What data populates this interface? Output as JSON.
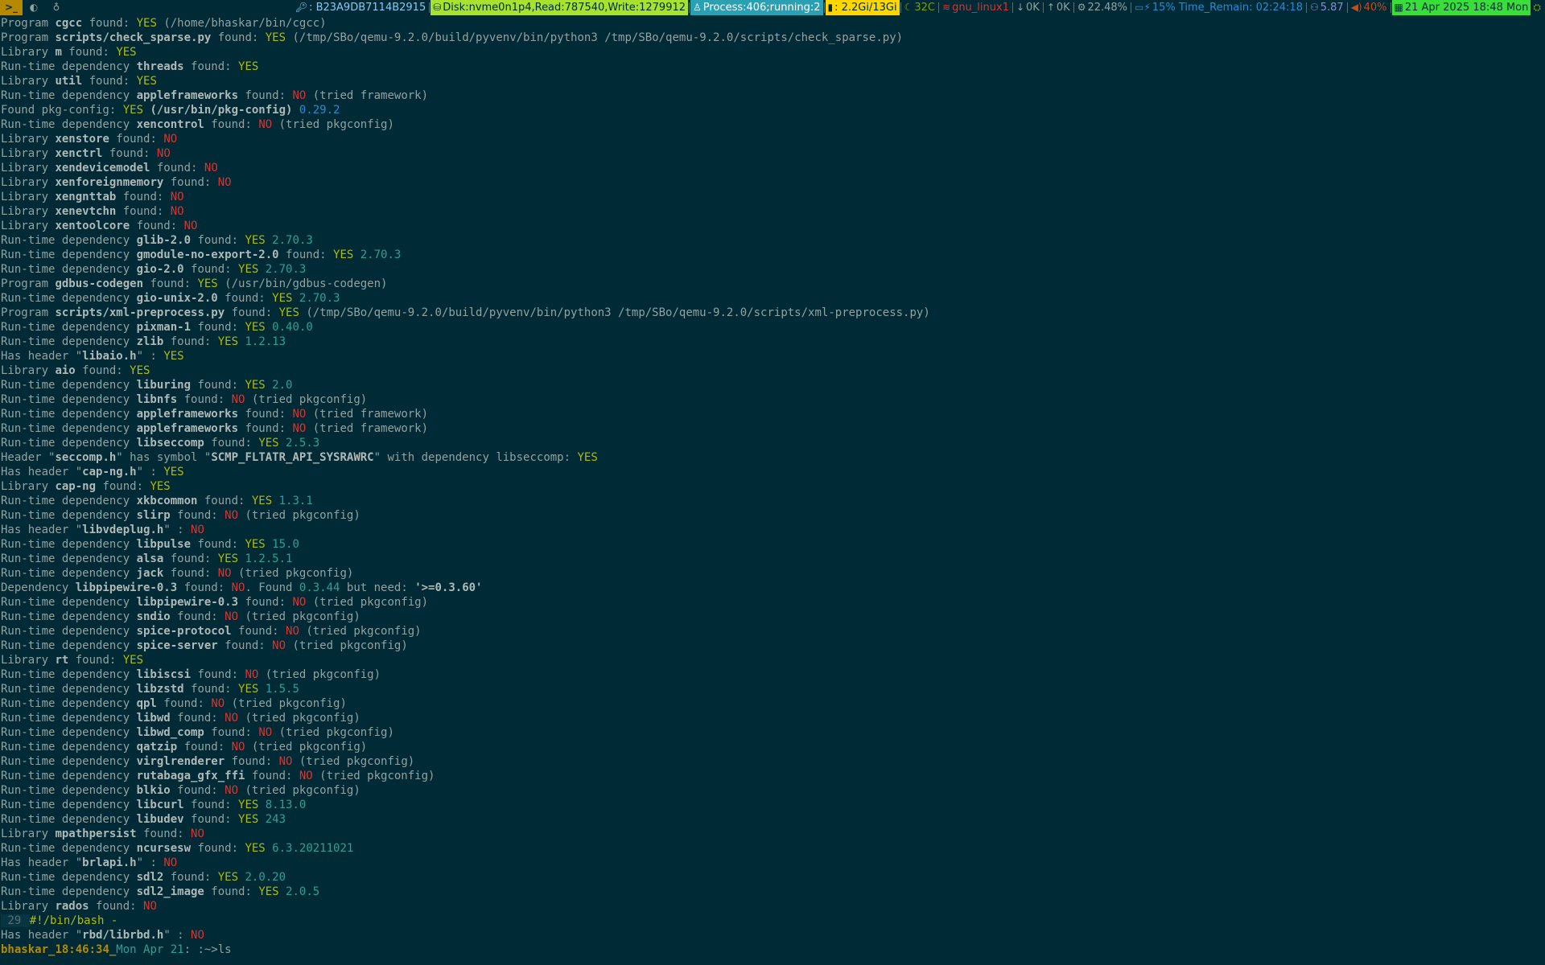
{
  "statusbar": {
    "workspaces": [
      {
        "label": ">_",
        "icon": "terminal-icon",
        "active": true
      },
      {
        "label": "◐",
        "icon": "browser-icon",
        "active": false
      },
      {
        "label": "♁",
        "icon": "linux-icon",
        "active": false
      }
    ],
    "key": ": B23A9DB7114B2915",
    "disk": "Disk:nvme0n1p4,Read:787540,Write:1279912",
    "process": "Process:406;running:2",
    "memory": ": 2.2Gi/13Gi",
    "temp": "32C",
    "network": "gnu_linux1",
    "down": "0K",
    "up": "0K",
    "cpu": "22.48%",
    "battery": "15% Time_Remain: 02:24:18",
    "load": "5.87",
    "volume": "40%",
    "datetime": "21 Apr 2025 18:48 Mon"
  },
  "terminal": {
    "lines": [
      [
        [
          "n",
          "Program "
        ],
        [
          "w",
          "cgcc"
        ],
        [
          "n",
          " found: "
        ],
        [
          "y",
          "YES"
        ],
        [
          "n",
          " (/home/bhaskar/bin/cgcc)"
        ]
      ],
      [
        [
          "n",
          "Program "
        ],
        [
          "w",
          "scripts/check_sparse.py"
        ],
        [
          "n",
          " found: "
        ],
        [
          "y",
          "YES"
        ],
        [
          "n",
          " (/tmp/SBo/qemu-9.2.0/build/pyvenv/bin/python3 /tmp/SBo/qemu-9.2.0/scripts/check_sparse.py)"
        ]
      ],
      [
        [
          "n",
          "Library "
        ],
        [
          "w",
          "m"
        ],
        [
          "n",
          " found: "
        ],
        [
          "y",
          "YES"
        ]
      ],
      [
        [
          "n",
          "Run-time dependency "
        ],
        [
          "w",
          "threads"
        ],
        [
          "n",
          " found: "
        ],
        [
          "y",
          "YES"
        ]
      ],
      [
        [
          "n",
          "Library "
        ],
        [
          "w",
          "util"
        ],
        [
          "n",
          " found: "
        ],
        [
          "y",
          "YES"
        ]
      ],
      [
        [
          "n",
          "Run-time dependency "
        ],
        [
          "w",
          "appleframeworks"
        ],
        [
          "n",
          " found: "
        ],
        [
          "r",
          "NO"
        ],
        [
          "n",
          " (tried framework)"
        ]
      ],
      [
        [
          "n",
          "Found pkg-config: "
        ],
        [
          "y",
          "YES"
        ],
        [
          "w",
          " (/usr/bin/pkg-config)"
        ],
        [
          "hl",
          " 0.29.2"
        ]
      ],
      [
        [
          "n",
          "Run-time dependency "
        ],
        [
          "w",
          "xencontrol"
        ],
        [
          "n",
          " found: "
        ],
        [
          "r",
          "NO"
        ],
        [
          "n",
          " (tried pkgconfig)"
        ]
      ],
      [
        [
          "n",
          "Library "
        ],
        [
          "w",
          "xenstore"
        ],
        [
          "n",
          " found: "
        ],
        [
          "r",
          "NO"
        ]
      ],
      [
        [
          "n",
          "Library "
        ],
        [
          "w",
          "xenctrl"
        ],
        [
          "n",
          " found: "
        ],
        [
          "r",
          "NO"
        ]
      ],
      [
        [
          "n",
          "Library "
        ],
        [
          "w",
          "xendevicemodel"
        ],
        [
          "n",
          " found: "
        ],
        [
          "r",
          "NO"
        ]
      ],
      [
        [
          "n",
          "Library "
        ],
        [
          "w",
          "xenforeignmemory"
        ],
        [
          "n",
          " found: "
        ],
        [
          "r",
          "NO"
        ]
      ],
      [
        [
          "n",
          "Library "
        ],
        [
          "w",
          "xengnttab"
        ],
        [
          "n",
          " found: "
        ],
        [
          "r",
          "NO"
        ]
      ],
      [
        [
          "n",
          "Library "
        ],
        [
          "w",
          "xenevtchn"
        ],
        [
          "n",
          " found: "
        ],
        [
          "r",
          "NO"
        ]
      ],
      [
        [
          "n",
          "Library "
        ],
        [
          "w",
          "xentoolcore"
        ],
        [
          "n",
          " found: "
        ],
        [
          "r",
          "NO"
        ]
      ],
      [
        [
          "n",
          "Run-time dependency "
        ],
        [
          "w",
          "glib-2.0"
        ],
        [
          "n",
          " found: "
        ],
        [
          "y",
          "YES"
        ],
        [
          "c",
          " 2.70.3"
        ]
      ],
      [
        [
          "n",
          "Run-time dependency "
        ],
        [
          "w",
          "gmodule-no-export-2.0"
        ],
        [
          "n",
          " found: "
        ],
        [
          "y",
          "YES"
        ],
        [
          "c",
          " 2.70.3"
        ]
      ],
      [
        [
          "n",
          "Run-time dependency "
        ],
        [
          "w",
          "gio-2.0"
        ],
        [
          "n",
          " found: "
        ],
        [
          "y",
          "YES"
        ],
        [
          "c",
          " 2.70.3"
        ]
      ],
      [
        [
          "n",
          "Program "
        ],
        [
          "w",
          "gdbus-codegen"
        ],
        [
          "n",
          " found: "
        ],
        [
          "y",
          "YES"
        ],
        [
          "n",
          " (/usr/bin/gdbus-codegen)"
        ]
      ],
      [
        [
          "n",
          "Run-time dependency "
        ],
        [
          "w",
          "gio-unix-2.0"
        ],
        [
          "n",
          " found: "
        ],
        [
          "y",
          "YES"
        ],
        [
          "c",
          " 2.70.3"
        ]
      ],
      [
        [
          "n",
          "Program "
        ],
        [
          "w",
          "scripts/xml-preprocess.py"
        ],
        [
          "n",
          " found: "
        ],
        [
          "y",
          "YES"
        ],
        [
          "n",
          " (/tmp/SBo/qemu-9.2.0/build/pyvenv/bin/python3 /tmp/SBo/qemu-9.2.0/scripts/xml-preprocess.py)"
        ]
      ],
      [
        [
          "n",
          "Run-time dependency "
        ],
        [
          "w",
          "pixman-1"
        ],
        [
          "n",
          " found: "
        ],
        [
          "y",
          "YES"
        ],
        [
          "c",
          " 0.40.0"
        ]
      ],
      [
        [
          "n",
          "Run-time dependency "
        ],
        [
          "w",
          "zlib"
        ],
        [
          "n",
          " found: "
        ],
        [
          "y",
          "YES"
        ],
        [
          "c",
          " 1.2.13"
        ]
      ],
      [
        [
          "n",
          "Has header \""
        ],
        [
          "w",
          "libaio.h"
        ],
        [
          "n",
          "\" : "
        ],
        [
          "y",
          "YES"
        ]
      ],
      [
        [
          "n",
          "Library "
        ],
        [
          "w",
          "aio"
        ],
        [
          "n",
          " found: "
        ],
        [
          "y",
          "YES"
        ]
      ],
      [
        [
          "n",
          "Run-time dependency "
        ],
        [
          "w",
          "liburing"
        ],
        [
          "n",
          " found: "
        ],
        [
          "y",
          "YES"
        ],
        [
          "c",
          " 2.0"
        ]
      ],
      [
        [
          "n",
          "Run-time dependency "
        ],
        [
          "w",
          "libnfs"
        ],
        [
          "n",
          " found: "
        ],
        [
          "r",
          "NO"
        ],
        [
          "n",
          " (tried pkgconfig)"
        ]
      ],
      [
        [
          "n",
          "Run-time dependency "
        ],
        [
          "w",
          "appleframeworks"
        ],
        [
          "n",
          " found: "
        ],
        [
          "r",
          "NO"
        ],
        [
          "n",
          " (tried framework)"
        ]
      ],
      [
        [
          "n",
          "Run-time dependency "
        ],
        [
          "w",
          "appleframeworks"
        ],
        [
          "n",
          " found: "
        ],
        [
          "r",
          "NO"
        ],
        [
          "n",
          " (tried framework)"
        ]
      ],
      [
        [
          "n",
          "Run-time dependency "
        ],
        [
          "w",
          "libseccomp"
        ],
        [
          "n",
          " found: "
        ],
        [
          "y",
          "YES"
        ],
        [
          "c",
          " 2.5.3"
        ]
      ],
      [
        [
          "n",
          "Header \""
        ],
        [
          "w",
          "seccomp.h"
        ],
        [
          "n",
          "\" has symbol \""
        ],
        [
          "w",
          "SCMP_FLTATR_API_SYSRAWRC"
        ],
        [
          "n",
          "\" with dependency libseccomp: "
        ],
        [
          "y",
          "YES"
        ]
      ],
      [
        [
          "n",
          "Has header \""
        ],
        [
          "w",
          "cap-ng.h"
        ],
        [
          "n",
          "\" : "
        ],
        [
          "y",
          "YES"
        ]
      ],
      [
        [
          "n",
          "Library "
        ],
        [
          "w",
          "cap-ng"
        ],
        [
          "n",
          " found: "
        ],
        [
          "y",
          "YES"
        ]
      ],
      [
        [
          "n",
          "Run-time dependency "
        ],
        [
          "w",
          "xkbcommon"
        ],
        [
          "n",
          " found: "
        ],
        [
          "y",
          "YES"
        ],
        [
          "c",
          " 1.3.1"
        ]
      ],
      [
        [
          "n",
          "Run-time dependency "
        ],
        [
          "w",
          "slirp"
        ],
        [
          "n",
          " found: "
        ],
        [
          "r",
          "NO"
        ],
        [
          "n",
          " (tried pkgconfig)"
        ]
      ],
      [
        [
          "n",
          "Has header \""
        ],
        [
          "w",
          "libvdeplug.h"
        ],
        [
          "n",
          "\" : "
        ],
        [
          "r",
          "NO"
        ]
      ],
      [
        [
          "n",
          "Run-time dependency "
        ],
        [
          "w",
          "libpulse"
        ],
        [
          "n",
          " found: "
        ],
        [
          "y",
          "YES"
        ],
        [
          "c",
          " 15.0"
        ]
      ],
      [
        [
          "n",
          "Run-time dependency "
        ],
        [
          "w",
          "alsa"
        ],
        [
          "n",
          " found: "
        ],
        [
          "y",
          "YES"
        ],
        [
          "c",
          " 1.2.5.1"
        ]
      ],
      [
        [
          "n",
          "Run-time dependency "
        ],
        [
          "w",
          "jack"
        ],
        [
          "n",
          " found: "
        ],
        [
          "r",
          "NO"
        ],
        [
          "n",
          " (tried pkgconfig)"
        ]
      ],
      [
        [
          "n",
          "Dependency "
        ],
        [
          "w",
          "libpipewire-0.3"
        ],
        [
          "n",
          " found: "
        ],
        [
          "r",
          "NO"
        ],
        [
          "n",
          ". Found "
        ],
        [
          "c",
          "0.3.44"
        ],
        [
          "n",
          " but need: "
        ],
        [
          "w",
          "'>=0.3.60'"
        ]
      ],
      [
        [
          "n",
          "Run-time dependency "
        ],
        [
          "w",
          "libpipewire-0.3"
        ],
        [
          "n",
          " found: "
        ],
        [
          "r",
          "NO"
        ],
        [
          "n",
          " (tried pkgconfig)"
        ]
      ],
      [
        [
          "n",
          "Run-time dependency "
        ],
        [
          "w",
          "sndio"
        ],
        [
          "n",
          " found: "
        ],
        [
          "r",
          "NO"
        ],
        [
          "n",
          " (tried pkgconfig)"
        ]
      ],
      [
        [
          "n",
          "Run-time dependency "
        ],
        [
          "w",
          "spice-protocol"
        ],
        [
          "n",
          " found: "
        ],
        [
          "r",
          "NO"
        ],
        [
          "n",
          " (tried pkgconfig)"
        ]
      ],
      [
        [
          "n",
          "Run-time dependency "
        ],
        [
          "w",
          "spice-server"
        ],
        [
          "n",
          " found: "
        ],
        [
          "r",
          "NO"
        ],
        [
          "n",
          " (tried pkgconfig)"
        ]
      ],
      [
        [
          "n",
          "Library "
        ],
        [
          "w",
          "rt"
        ],
        [
          "n",
          " found: "
        ],
        [
          "y",
          "YES"
        ]
      ],
      [
        [
          "n",
          "Run-time dependency "
        ],
        [
          "w",
          "libiscsi"
        ],
        [
          "n",
          " found: "
        ],
        [
          "r",
          "NO"
        ],
        [
          "n",
          " (tried pkgconfig)"
        ]
      ],
      [
        [
          "n",
          "Run-time dependency "
        ],
        [
          "w",
          "libzstd"
        ],
        [
          "n",
          " found: "
        ],
        [
          "y",
          "YES"
        ],
        [
          "c",
          " 1.5.5"
        ]
      ],
      [
        [
          "n",
          "Run-time dependency "
        ],
        [
          "w",
          "qpl"
        ],
        [
          "n",
          " found: "
        ],
        [
          "r",
          "NO"
        ],
        [
          "n",
          " (tried pkgconfig)"
        ]
      ],
      [
        [
          "n",
          "Run-time dependency "
        ],
        [
          "w",
          "libwd"
        ],
        [
          "n",
          " found: "
        ],
        [
          "r",
          "NO"
        ],
        [
          "n",
          " (tried pkgconfig)"
        ]
      ],
      [
        [
          "n",
          "Run-time dependency "
        ],
        [
          "w",
          "libwd_comp"
        ],
        [
          "n",
          " found: "
        ],
        [
          "r",
          "NO"
        ],
        [
          "n",
          " (tried pkgconfig)"
        ]
      ],
      [
        [
          "n",
          "Run-time dependency "
        ],
        [
          "w",
          "qatzip"
        ],
        [
          "n",
          " found: "
        ],
        [
          "r",
          "NO"
        ],
        [
          "n",
          " (tried pkgconfig)"
        ]
      ],
      [
        [
          "n",
          "Run-time dependency "
        ],
        [
          "w",
          "virglrenderer"
        ],
        [
          "n",
          " found: "
        ],
        [
          "r",
          "NO"
        ],
        [
          "n",
          " (tried pkgconfig)"
        ]
      ],
      [
        [
          "n",
          "Run-time dependency "
        ],
        [
          "w",
          "rutabaga_gfx_ffi"
        ],
        [
          "n",
          " found: "
        ],
        [
          "r",
          "NO"
        ],
        [
          "n",
          " (tried pkgconfig)"
        ]
      ],
      [
        [
          "n",
          "Run-time dependency "
        ],
        [
          "w",
          "blkio"
        ],
        [
          "n",
          " found: "
        ],
        [
          "r",
          "NO"
        ],
        [
          "n",
          " (tried pkgconfig)"
        ]
      ],
      [
        [
          "n",
          "Run-time dependency "
        ],
        [
          "w",
          "libcurl"
        ],
        [
          "n",
          " found: "
        ],
        [
          "y",
          "YES"
        ],
        [
          "c",
          " 8.13.0"
        ]
      ],
      [
        [
          "n",
          "Run-time dependency "
        ],
        [
          "w",
          "libudev"
        ],
        [
          "n",
          " found: "
        ],
        [
          "y",
          "YES"
        ],
        [
          "c",
          " 243"
        ]
      ],
      [
        [
          "n",
          "Library "
        ],
        [
          "w",
          "mpathpersist"
        ],
        [
          "n",
          " found: "
        ],
        [
          "r",
          "NO"
        ]
      ],
      [
        [
          "n",
          "Run-time dependency "
        ],
        [
          "w",
          "ncursesw"
        ],
        [
          "n",
          " found: "
        ],
        [
          "y",
          "YES"
        ],
        [
          "c",
          " 6.3.20211021"
        ]
      ],
      [
        [
          "n",
          "Has header \""
        ],
        [
          "w",
          "brlapi.h"
        ],
        [
          "n",
          "\" : "
        ],
        [
          "r",
          "NO"
        ]
      ],
      [
        [
          "n",
          "Run-time dependency "
        ],
        [
          "w",
          "sdl2"
        ],
        [
          "n",
          " found: "
        ],
        [
          "y",
          "YES"
        ],
        [
          "c",
          " 2.0.20"
        ]
      ],
      [
        [
          "n",
          "Run-time dependency "
        ],
        [
          "w",
          "sdl2_image"
        ],
        [
          "n",
          " found: "
        ],
        [
          "y",
          "YES"
        ],
        [
          "c",
          " 2.0.5"
        ]
      ],
      [
        [
          "n",
          "Library "
        ],
        [
          "w",
          "rados"
        ],
        [
          "n",
          " found: "
        ],
        [
          "r",
          "NO"
        ]
      ],
      [
        [
          "lnum",
          " 29 "
        ],
        [
          "sh",
          "#!/bin/bash -"
        ]
      ],
      [
        [
          "n",
          "Has header \""
        ],
        [
          "w",
          "rbd/librbd.h"
        ],
        [
          "n",
          "\" : "
        ],
        [
          "r",
          "NO"
        ]
      ]
    ],
    "prompt": {
      "user": "bhaskar_",
      "time": "18:46:34_",
      "day": "Mon Apr 21",
      "rest": ": :~>ls"
    }
  }
}
